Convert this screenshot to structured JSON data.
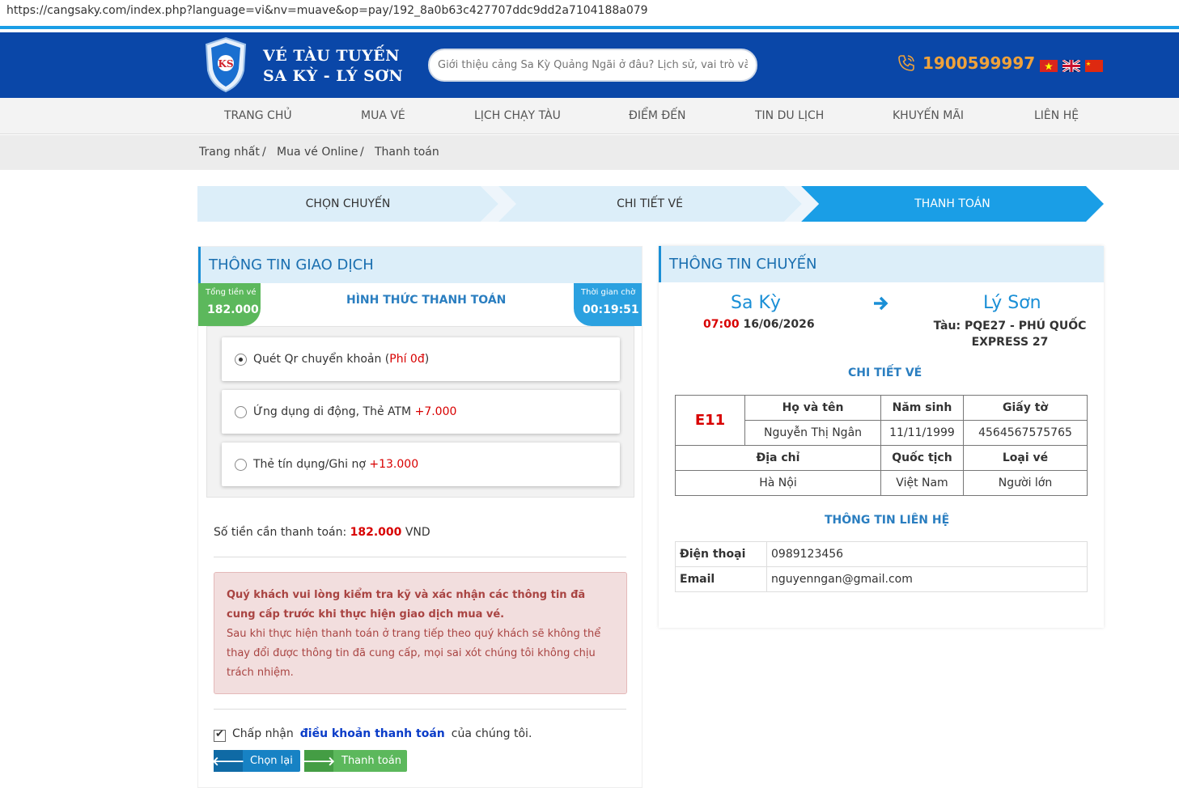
{
  "browser": {
    "url": "https://cangsaky.com/index.php?language=vi&nv=muave&op=pay/192_8a0b63c427707ddc9dd2a7104188a079"
  },
  "header": {
    "brand_line1": "VÉ TÀU TUYẾN",
    "brand_line2": "SA KỲ - LÝ SƠN",
    "search_placeholder": "Giới thiệu cảng Sa Kỳ Quảng Ngãi ở đâu? Lịch sử, vai trò và d",
    "phone": "1900599997",
    "colors": {
      "header_bg": "#0a47a8",
      "accent_orange": "#f0a23a"
    }
  },
  "nav": {
    "items": [
      "TRANG CHỦ",
      "MUA VÉ",
      "LỊCH CHẠY TÀU",
      "ĐIỂM ĐẾN",
      "TIN DU LỊCH",
      "KHUYẾN MÃI",
      "LIÊN HỆ"
    ]
  },
  "breadcrumb": {
    "items": [
      "Trang nhất",
      "Mua vé Online",
      "Thanh toán"
    ],
    "sep": "/"
  },
  "steps": {
    "items": [
      "CHỌN CHUYẾN",
      "CHI TIẾT VÉ",
      "THANH TOÁN"
    ],
    "active": 2
  },
  "transaction": {
    "title": "THÔNG TIN GIAO DỊCH",
    "total_label": "Tổng tiền vé",
    "total_value": "182.000",
    "wait_label": "Thời gian chờ",
    "wait_value": "00:19:51",
    "methods_title": "HÌNH THỨC THANH TOÁN",
    "methods": [
      {
        "label": "Quét Qr chuyển khoản (",
        "fee": "Phí 0đ",
        "after": ")",
        "selected": true
      },
      {
        "label": "Ứng dụng di động, Thẻ ATM ",
        "fee": "+7.000",
        "after": "",
        "selected": false
      },
      {
        "label": "Thẻ tín dụng/Ghi nợ ",
        "fee": "+13.000",
        "after": "",
        "selected": false
      }
    ],
    "amount_label": "Số tiền cần thanh toán:",
    "amount_value": "182.000",
    "amount_unit": "VND",
    "alert_bold": "Quý khách vui lòng kiểm tra kỹ và xác nhận các thông tin đã cung cấp trước khi thực hiện giao dịch mua vé.",
    "alert_text": "Sau khi thực hiện thanh toán ở trang tiếp theo quý khách sẽ không thể thay đổi được thông tin đã cung cấp, mọi sai xót chúng tôi không chịu trách nhiệm.",
    "terms_pre": "Chấp nhận",
    "terms_link": "điều khoản thanh toán",
    "terms_post": "của chúng tôi.",
    "back_button": "Chọn lại",
    "pay_button": "Thanh toán"
  },
  "trip": {
    "title": "THÔNG TIN CHUYẾN",
    "from": "Sa Kỳ",
    "to": "Lý Sơn",
    "time": "07:00",
    "date": "16/06/2026",
    "ship_line1": "Tàu: PQE27 - PHÚ QUỐC",
    "ship_line2": "EXPRESS 27",
    "ticket_title": "CHI TIẾT VÉ",
    "seat": "E11",
    "headers1": [
      "Họ và tên",
      "Năm sinh",
      "Giấy tờ"
    ],
    "row1": [
      "Nguyễn Thị Ngân",
      "11/11/1999",
      "4564567575765"
    ],
    "headers2": [
      "Địa chỉ",
      "Quốc tịch",
      "Loại vé"
    ],
    "row2": [
      "Hà Nội",
      "Việt Nam",
      "Người lớn"
    ],
    "contact_title": "THÔNG TIN LIÊN HỆ",
    "contact": [
      {
        "label": "Điện thoại",
        "value": "0989123456"
      },
      {
        "label": "Email",
        "value": "nguyenngan@gmail.com"
      }
    ]
  }
}
